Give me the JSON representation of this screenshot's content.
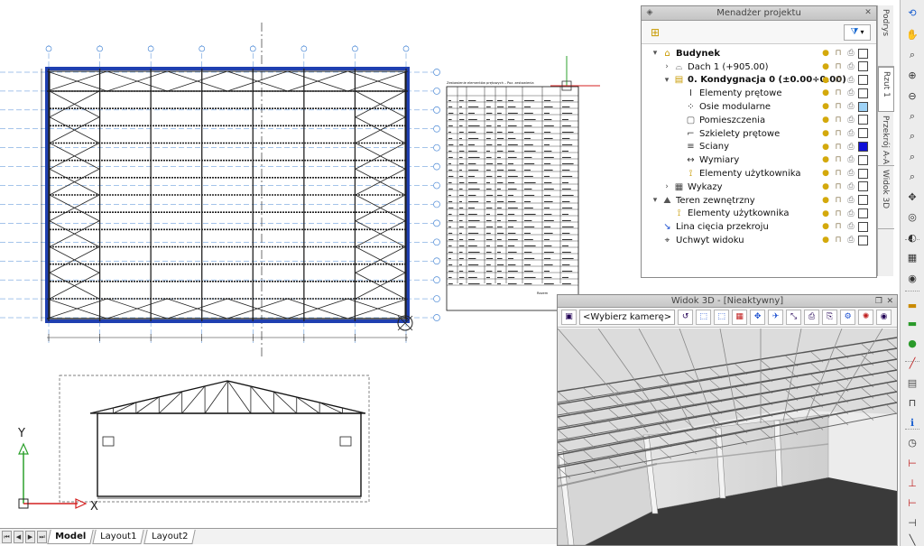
{
  "layout_tabs": {
    "model": "Model",
    "layout1": "Layout1",
    "layout2": "Layout2"
  },
  "ucs": {
    "y_label": "Y",
    "x_label": "X"
  },
  "drawing": {
    "table_title": "Zestawienie elementów prętowych – Poz. zestawienia",
    "table_footer": "Razem"
  },
  "project_manager": {
    "title": "Menadżer projektu",
    "filter_icon": "funnel-icon",
    "items": [
      {
        "label": "Budynek",
        "bold": true,
        "toggle": "▾",
        "icon": "building-icon"
      },
      {
        "label": "Dach 1 (+905.00)",
        "bold": false,
        "toggle": "›",
        "icon": "roof-icon"
      },
      {
        "label": "0. Kondygnacja 0 (±0.00÷0.00)",
        "bold": true,
        "toggle": "▾",
        "icon": "storey-icon"
      },
      {
        "label": "Elementy prętowe",
        "bold": false,
        "toggle": "",
        "icon": "beam-icon"
      },
      {
        "label": "Osie modularne",
        "bold": false,
        "toggle": "",
        "icon": "grid-axes-icon"
      },
      {
        "label": "Pomieszczenia",
        "bold": false,
        "toggle": "",
        "icon": "room-icon"
      },
      {
        "label": "Szkielety prętowe",
        "bold": false,
        "toggle": "",
        "icon": "frame-icon"
      },
      {
        "label": "Ściany",
        "bold": false,
        "toggle": "",
        "icon": "wall-icon"
      },
      {
        "label": "Wymiary",
        "bold": false,
        "toggle": "",
        "icon": "dimension-icon"
      },
      {
        "label": "Elementy użytkownika",
        "bold": false,
        "toggle": "",
        "icon": "user-elements-icon"
      },
      {
        "label": "Wykazy",
        "bold": false,
        "toggle": "›",
        "icon": "schedule-icon"
      },
      {
        "label": "Teren zewnętrzny",
        "bold": false,
        "toggle": "▾",
        "icon": "terrain-icon"
      },
      {
        "label": "Elementy użytkownika",
        "bold": false,
        "toggle": "",
        "icon": "user-elements-icon"
      },
      {
        "label": "Lina cięcia przekroju",
        "bold": false,
        "toggle": "",
        "icon": "section-line-icon"
      },
      {
        "label": "Uchwyt widoku",
        "bold": false,
        "toggle": "",
        "icon": "view-handle-icon"
      }
    ],
    "swatch_colors": [
      "#ffffff",
      "#ffffff",
      "#ffffff",
      "#ffffff",
      "#9fd3f7",
      "#ffffff",
      "#ffffff",
      "#1010d8",
      "#ffffff",
      "#ffffff",
      "#ffffff",
      "#ffffff",
      "#ffffff",
      "#ffffff",
      "#ffffff"
    ]
  },
  "vertical_tabs": [
    "Podrys",
    "Rzut 1",
    "Przekrój A-A",
    "Widok 3D"
  ],
  "view3d": {
    "title": "Widok 3D - [Nieaktywny]",
    "camera_placeholder": "<Wybierz kamerę>"
  },
  "colors": {
    "accent_blue": "#1f3fb0",
    "axis_blue": "#4a88d6",
    "ucs_green": "#2ca02c",
    "ucs_red": "#d42020",
    "swatch_blue": "#1010d8",
    "swatch_light": "#9fd3f7"
  }
}
